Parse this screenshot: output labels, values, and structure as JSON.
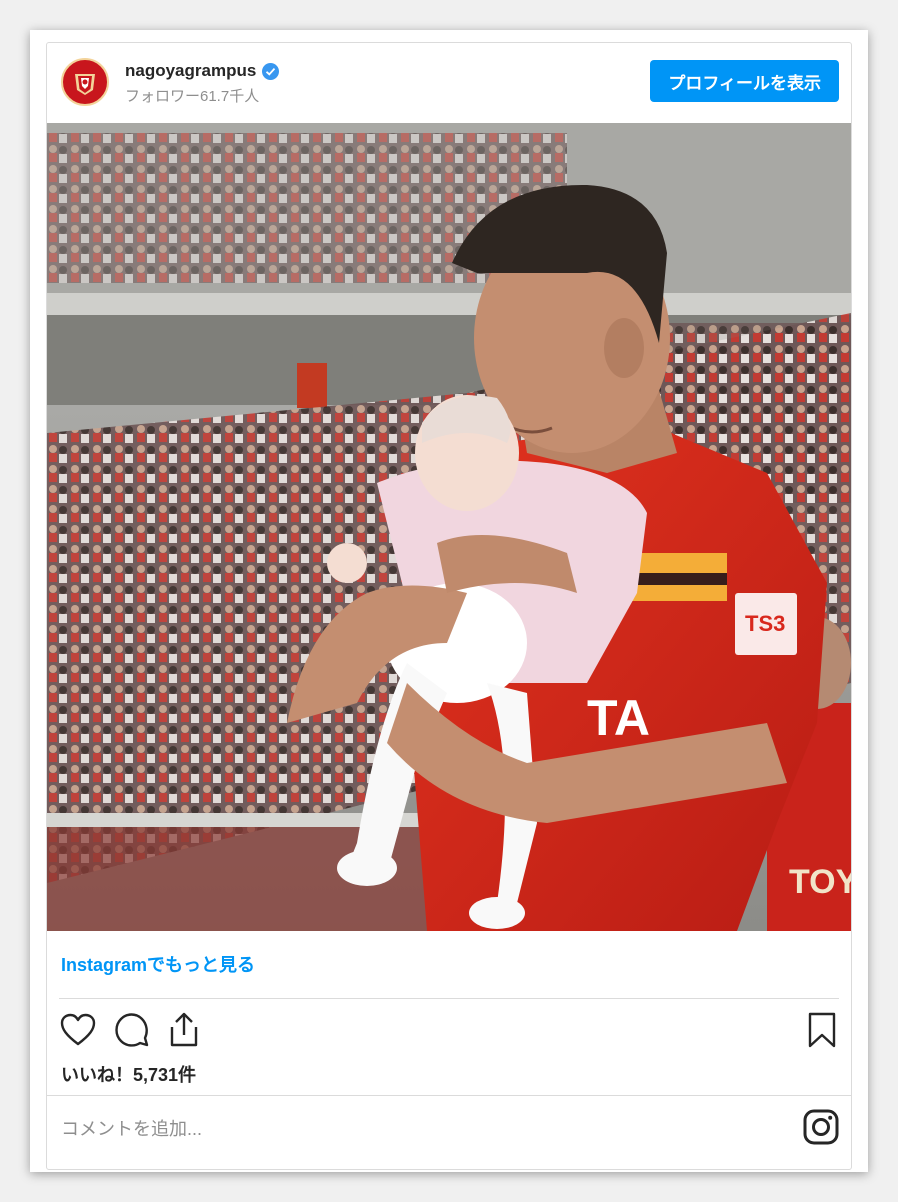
{
  "post": {
    "username": "nagoyagrampus",
    "followers": "フォロワー61.7千人",
    "profile_button": "プロフィールを表示",
    "more_link": "Instagramでもっと見る",
    "likes": "いいね！5,731件",
    "comment_placeholder": "コメントを追加...",
    "photo_shirt_text": "TA",
    "photo_sleeve_patch": "TS3",
    "photo_bg_shirt_text": "TOYO"
  },
  "colors": {
    "accent": "#0095f6",
    "verified": "#3897f0",
    "jersey_red": "#d8281d",
    "text": "#262626",
    "muted": "#8e8e8e"
  }
}
